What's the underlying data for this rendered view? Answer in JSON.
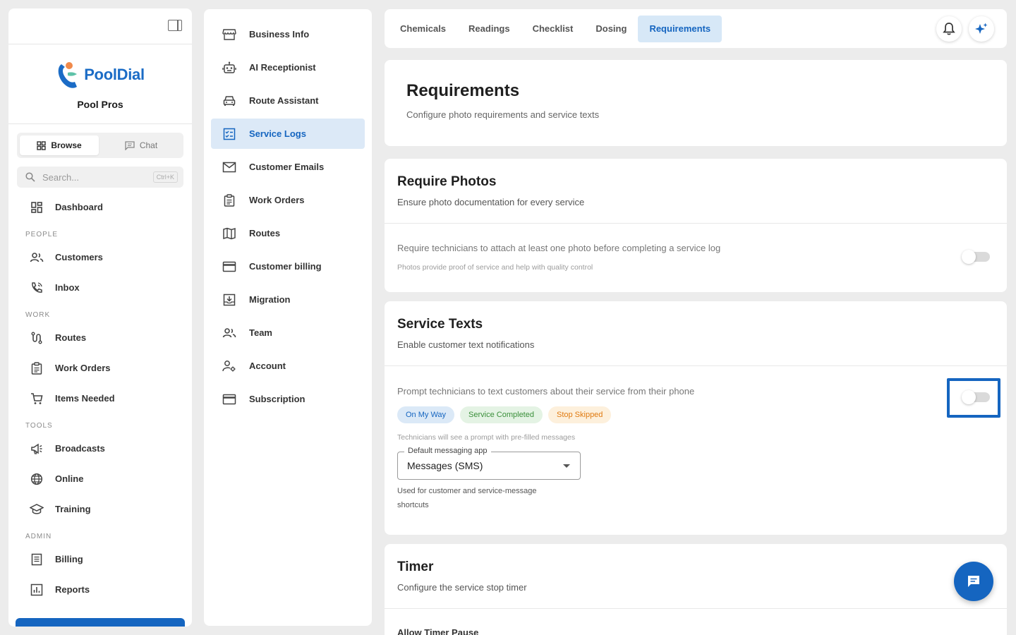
{
  "sidebar": {
    "brand": "PoolDial",
    "org_name": "Pool Pros",
    "toggle": {
      "browse": "Browse",
      "chat": "Chat"
    },
    "search": {
      "placeholder": "Search...",
      "shortcut": "Ctrl+K"
    },
    "dashboard": "Dashboard",
    "sections": {
      "people": "PEOPLE",
      "work": "WORK",
      "tools": "TOOLS",
      "admin": "ADMIN"
    },
    "items": {
      "customers": "Customers",
      "inbox": "Inbox",
      "routes": "Routes",
      "work_orders": "Work Orders",
      "items_needed": "Items Needed",
      "broadcasts": "Broadcasts",
      "online": "Online",
      "training": "Training",
      "billing": "Billing",
      "reports": "Reports"
    }
  },
  "settings_menu": {
    "items": [
      "Business Info",
      "AI Receptionist",
      "Route Assistant",
      "Service Logs",
      "Customer Emails",
      "Work Orders",
      "Routes",
      "Customer billing",
      "Migration",
      "Team",
      "Account",
      "Subscription"
    ],
    "active": "Service Logs"
  },
  "tabs": {
    "items": [
      "Chemicals",
      "Readings",
      "Checklist",
      "Dosing",
      "Requirements"
    ],
    "active": "Requirements"
  },
  "header": {
    "title": "Requirements",
    "subtitle": "Configure photo requirements and service texts"
  },
  "require_photos": {
    "title": "Require Photos",
    "subtitle": "Ensure photo documentation for every service",
    "description": "Require technicians to attach at least one photo before completing a service log",
    "note": "Photos provide proof of service and help with quality control",
    "enabled": false
  },
  "service_texts": {
    "title": "Service Texts",
    "subtitle": "Enable customer text notifications",
    "description": "Prompt technicians to text customers about their service from their phone",
    "chips": [
      "On My Way",
      "Service Completed",
      "Stop Skipped"
    ],
    "note": "Technicians will see a prompt with pre-filled messages",
    "enabled": false,
    "select": {
      "label": "Default messaging app",
      "value": "Messages (SMS)",
      "helper": "Used for customer and service-message shortcuts"
    }
  },
  "timer": {
    "title": "Timer",
    "subtitle": "Configure the service stop timer",
    "first_option": "Allow Timer Pause"
  },
  "colors": {
    "accent": "#1565c0",
    "active_bg": "#dce9f7"
  }
}
